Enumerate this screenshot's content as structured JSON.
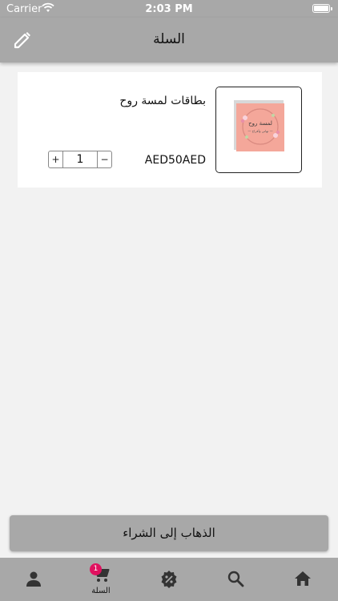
{
  "status_bar": {
    "carrier": "Carrier",
    "time": "2:03 PM"
  },
  "header": {
    "title": "السلة",
    "edit_icon": "pencil-icon"
  },
  "cart": {
    "items": [
      {
        "name": "بطاقات لمسة روح",
        "price": "AED50AED",
        "quantity": "1",
        "plus_label": "+",
        "minus_label": "−",
        "image_text": [
          "لمسة روح",
          "— تهاني وأفراح —"
        ]
      }
    ]
  },
  "checkout": {
    "label": "الذهاب إلى الشراء"
  },
  "tabs": {
    "cart_label": "السلة",
    "cart_badge": "1",
    "icons": [
      "profile-icon",
      "cart-icon",
      "discount-icon",
      "search-icon",
      "home-icon"
    ]
  },
  "colors": {
    "bar_background": "#a8a8a8",
    "page_background": "#f2f2f2",
    "badge": "#e0115f"
  }
}
